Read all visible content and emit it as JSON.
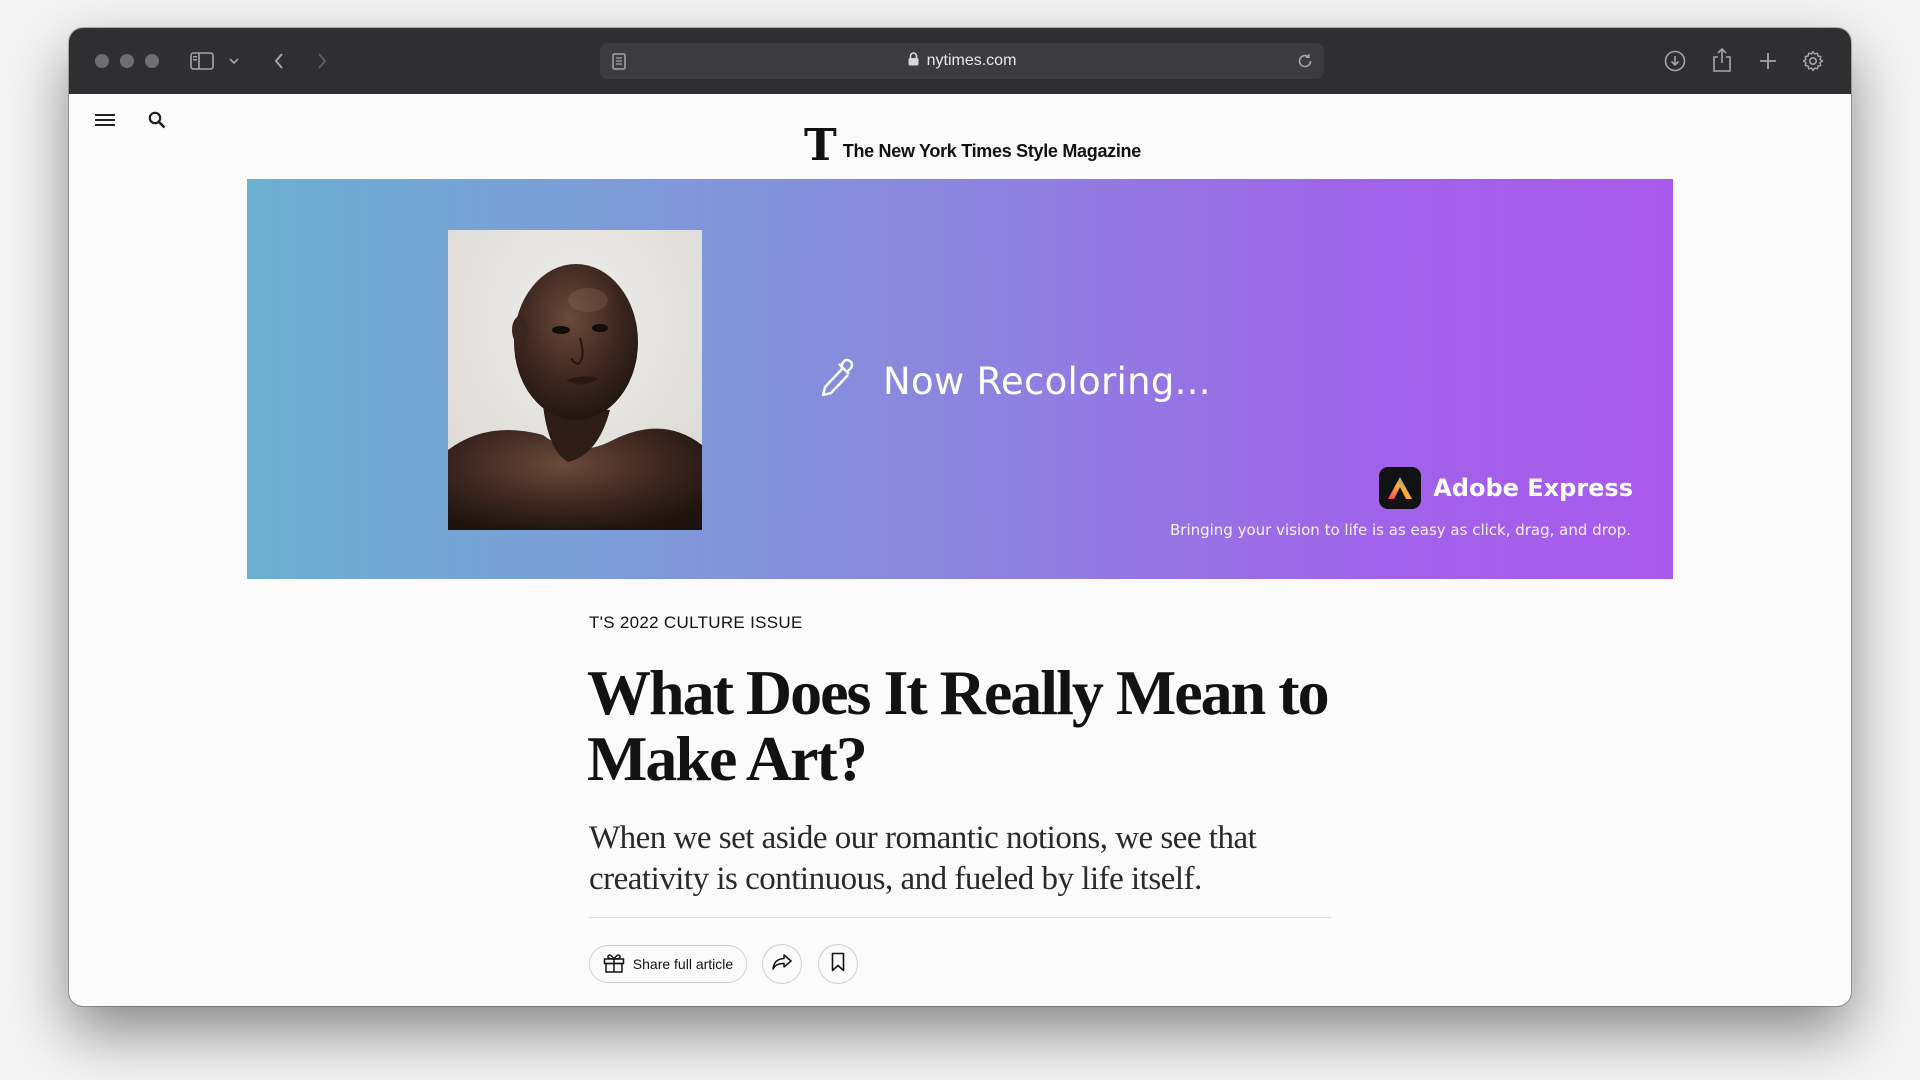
{
  "browser": {
    "url": "nytimes.com"
  },
  "site": {
    "masthead_logo": "T",
    "masthead_title": "The New York Times Style Magazine"
  },
  "ad": {
    "status_text": "Now Recoloring...",
    "brand_name": "Adobe Express",
    "tagline": "Bringing your vision to life is as easy as click, drag, and drop.",
    "photo_alt": "Portrait photo",
    "colors": {
      "gradient_start": "#6bb0d0",
      "gradient_end": "#a95aed"
    }
  },
  "article": {
    "kicker": "T'S 2022 CULTURE ISSUE",
    "headline": "What Does It Really Mean to Make Art?",
    "dek": "When we set aside our romantic notions, we see that creativity is continuous, and fueled by life itself.",
    "share_full_label": "Share full article"
  },
  "icons": {
    "sidebar": "sidebar-icon",
    "back": "chevron-left-icon",
    "forward": "chevron-right-icon",
    "reader": "reader-icon",
    "lock": "lock-icon",
    "reload": "reload-icon",
    "download": "download-icon",
    "share": "share-icon",
    "new_tab": "plus-icon",
    "settings": "gear-icon",
    "menu": "hamburger-icon",
    "search": "search-icon",
    "eyedropper": "eyedropper-icon",
    "gift": "gift-icon",
    "bookmark": "bookmark-icon"
  }
}
